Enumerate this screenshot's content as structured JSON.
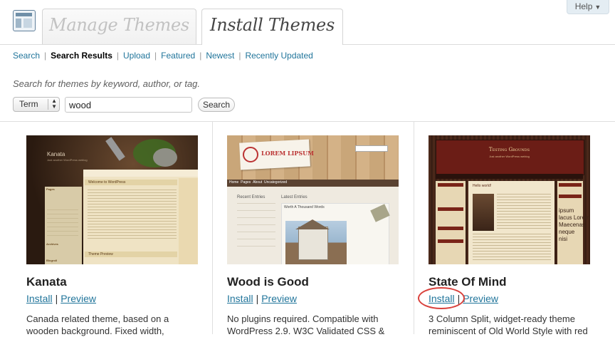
{
  "header": {
    "tabs": [
      {
        "label": "Manage Themes",
        "active": false
      },
      {
        "label": "Install Themes",
        "active": true
      }
    ],
    "help_label": "Help"
  },
  "subnav": {
    "items": [
      {
        "label": "Search",
        "current": false
      },
      {
        "label": "Search Results",
        "current": true
      },
      {
        "label": "Upload",
        "current": false
      },
      {
        "label": "Featured",
        "current": false
      },
      {
        "label": "Newest",
        "current": false
      },
      {
        "label": "Recently Updated",
        "current": false
      }
    ]
  },
  "search": {
    "hint": "Search for themes by keyword, author, or tag.",
    "select_value": "Term",
    "query": "wood",
    "button_label": "Search"
  },
  "themes": [
    {
      "title": "Kanata",
      "install_label": "Install",
      "preview_label": "Preview",
      "description": "Canada related theme, based on a wooden background. Fixed width,",
      "thumb_text": {
        "site_title": "Kanata",
        "tagline": "Just another WordPress weblog",
        "post_title": "Welcome to WordPress",
        "sidebar_pages": "Pages",
        "sidebar_archives": "Archives",
        "sidebar_blogroll": "Blogroll",
        "post2_title": "Theme Preview"
      }
    },
    {
      "title": "Wood is Good",
      "install_label": "Install",
      "preview_label": "Preview",
      "description": "No plugins required. Compatible with WordPress 2.9. W3C Validated CSS &",
      "thumb_text": {
        "logo": "LOREM LIPSUM",
        "nav": [
          "Home",
          "Pages",
          "About",
          "Uncategorized"
        ],
        "recent_entries": "Recent Entries",
        "latest_entries": "Latest Entries",
        "post_title": "Worth A Thousand Words"
      }
    },
    {
      "title": "State Of Mind",
      "install_label": "Install",
      "preview_label": "Preview",
      "description": "3 Column Split, widget-ready theme reminiscent of Old World Style with red",
      "thumb_text": {
        "site_title": "Testing Grounds",
        "tagline": "Just another WordPress weblog",
        "post_title": "Hello world!",
        "right_text": [
          "ipsum",
          "lacus Lorem",
          "Maecenas",
          "neque",
          "nisi"
        ]
      }
    }
  ],
  "colors": {
    "link": "#21759b",
    "annotation_circle": "#d9413c"
  }
}
